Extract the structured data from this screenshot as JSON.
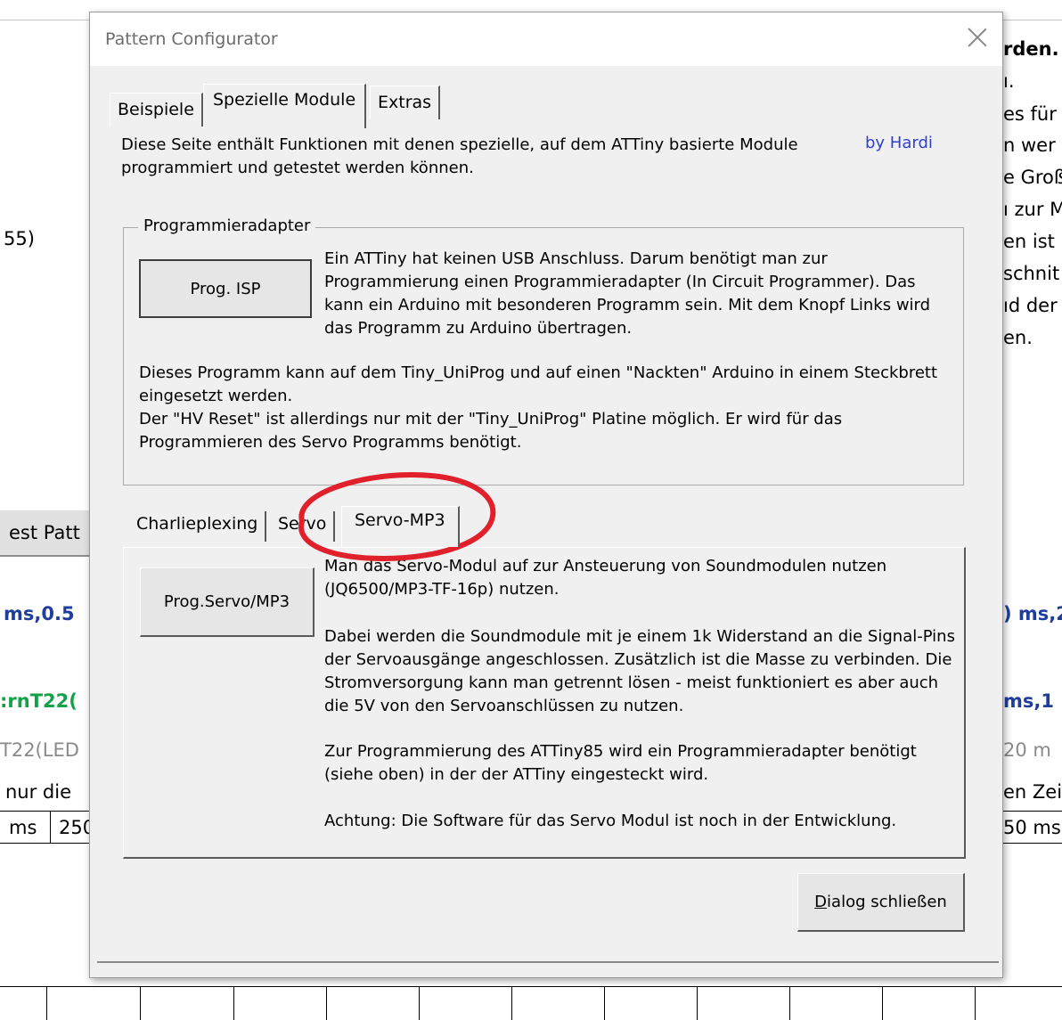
{
  "background": {
    "left_column": [
      "55)",
      "ms,0.5",
      ":rnT22(",
      "T22(LED",
      "nur die",
      "ms",
      "250"
    ],
    "button_partial": "est Patt",
    "right_column": [
      "rden.",
      "ı.",
      "es für",
      "n wer",
      "e Groß",
      "ı zur M",
      "en ist",
      "schnit",
      "ıd der",
      "en.",
      ") ms,2",
      "ms,1",
      "20 m",
      "en Zei",
      "50 ms"
    ]
  },
  "dialog": {
    "title": "Pattern Configurator",
    "tabs": [
      "Beispiele",
      "Spezielle Module",
      "Extras"
    ],
    "active_tab": "Spezielle Module",
    "intro_text": "Diese Seite enthält Funktionen mit denen spezielle, auf dem ATTiny basierte Module programmiert und getestet werden können.",
    "byline": "by Hardi",
    "group_label": "Programmieradapter",
    "prog_isp_label": "Prog. ISP",
    "isp_description": "Ein ATTiny hat keinen USB Anschluss. Darum benötigt man zur Programmierung einen Programmieradapter (In Circuit Programmer). Das kann ein Arduino mit besonderen Programm sein. Mit dem Knopf Links wird das Programm zu Arduino übertragen.",
    "isp_note_1": "Dieses Programm kann auf dem Tiny_UniProg und auf einen \"Nackten\" Arduino in einem Steckbrett eingesetzt werden.",
    "isp_note_2": "Der \"HV Reset\" ist allerdings nur mit der \"Tiny_UniProg\" Platine möglich. Er wird für das Programmieren des Servo Programms benötigt.",
    "inner_tabs": [
      "Charlieplexing",
      "Servo",
      "Servo-MP3"
    ],
    "active_inner_tab": "Servo-MP3",
    "prog_servo_label": "Prog.Servo/MP3",
    "mp3_para_1": "Man das Servo-Modul auf zur Ansteuerung von Soundmodulen nutzen (JQ6500/MP3-TF-16p) nutzen.",
    "mp3_para_2": "Dabei werden die Soundmodule mit je einem 1k Widerstand an die Signal-Pins der Servoausgänge angeschlossen. Zusätzlich ist die Masse zu verbinden. Die Stromversorgung kann man getrennt lösen - meist funktioniert es aber auch die 5V von den Servoanschlüssen zu nutzen.",
    "mp3_para_3": "Zur Programmierung des ATTiny85 wird ein Programmieradapter benötigt (siehe oben) in der der ATTiny eingesteckt wird.",
    "mp3_para_4": "Achtung: Die Software für das Servo Modul ist noch in der Entwicklung.",
    "close_button_label": "Dialog schließen"
  },
  "colors": {
    "dialog_bg": "#f0f0f0",
    "byline": "#2f3fcf",
    "annotation": "#e0202a",
    "bg_blue": "#1f3e9c",
    "bg_green": "#14a14a"
  }
}
